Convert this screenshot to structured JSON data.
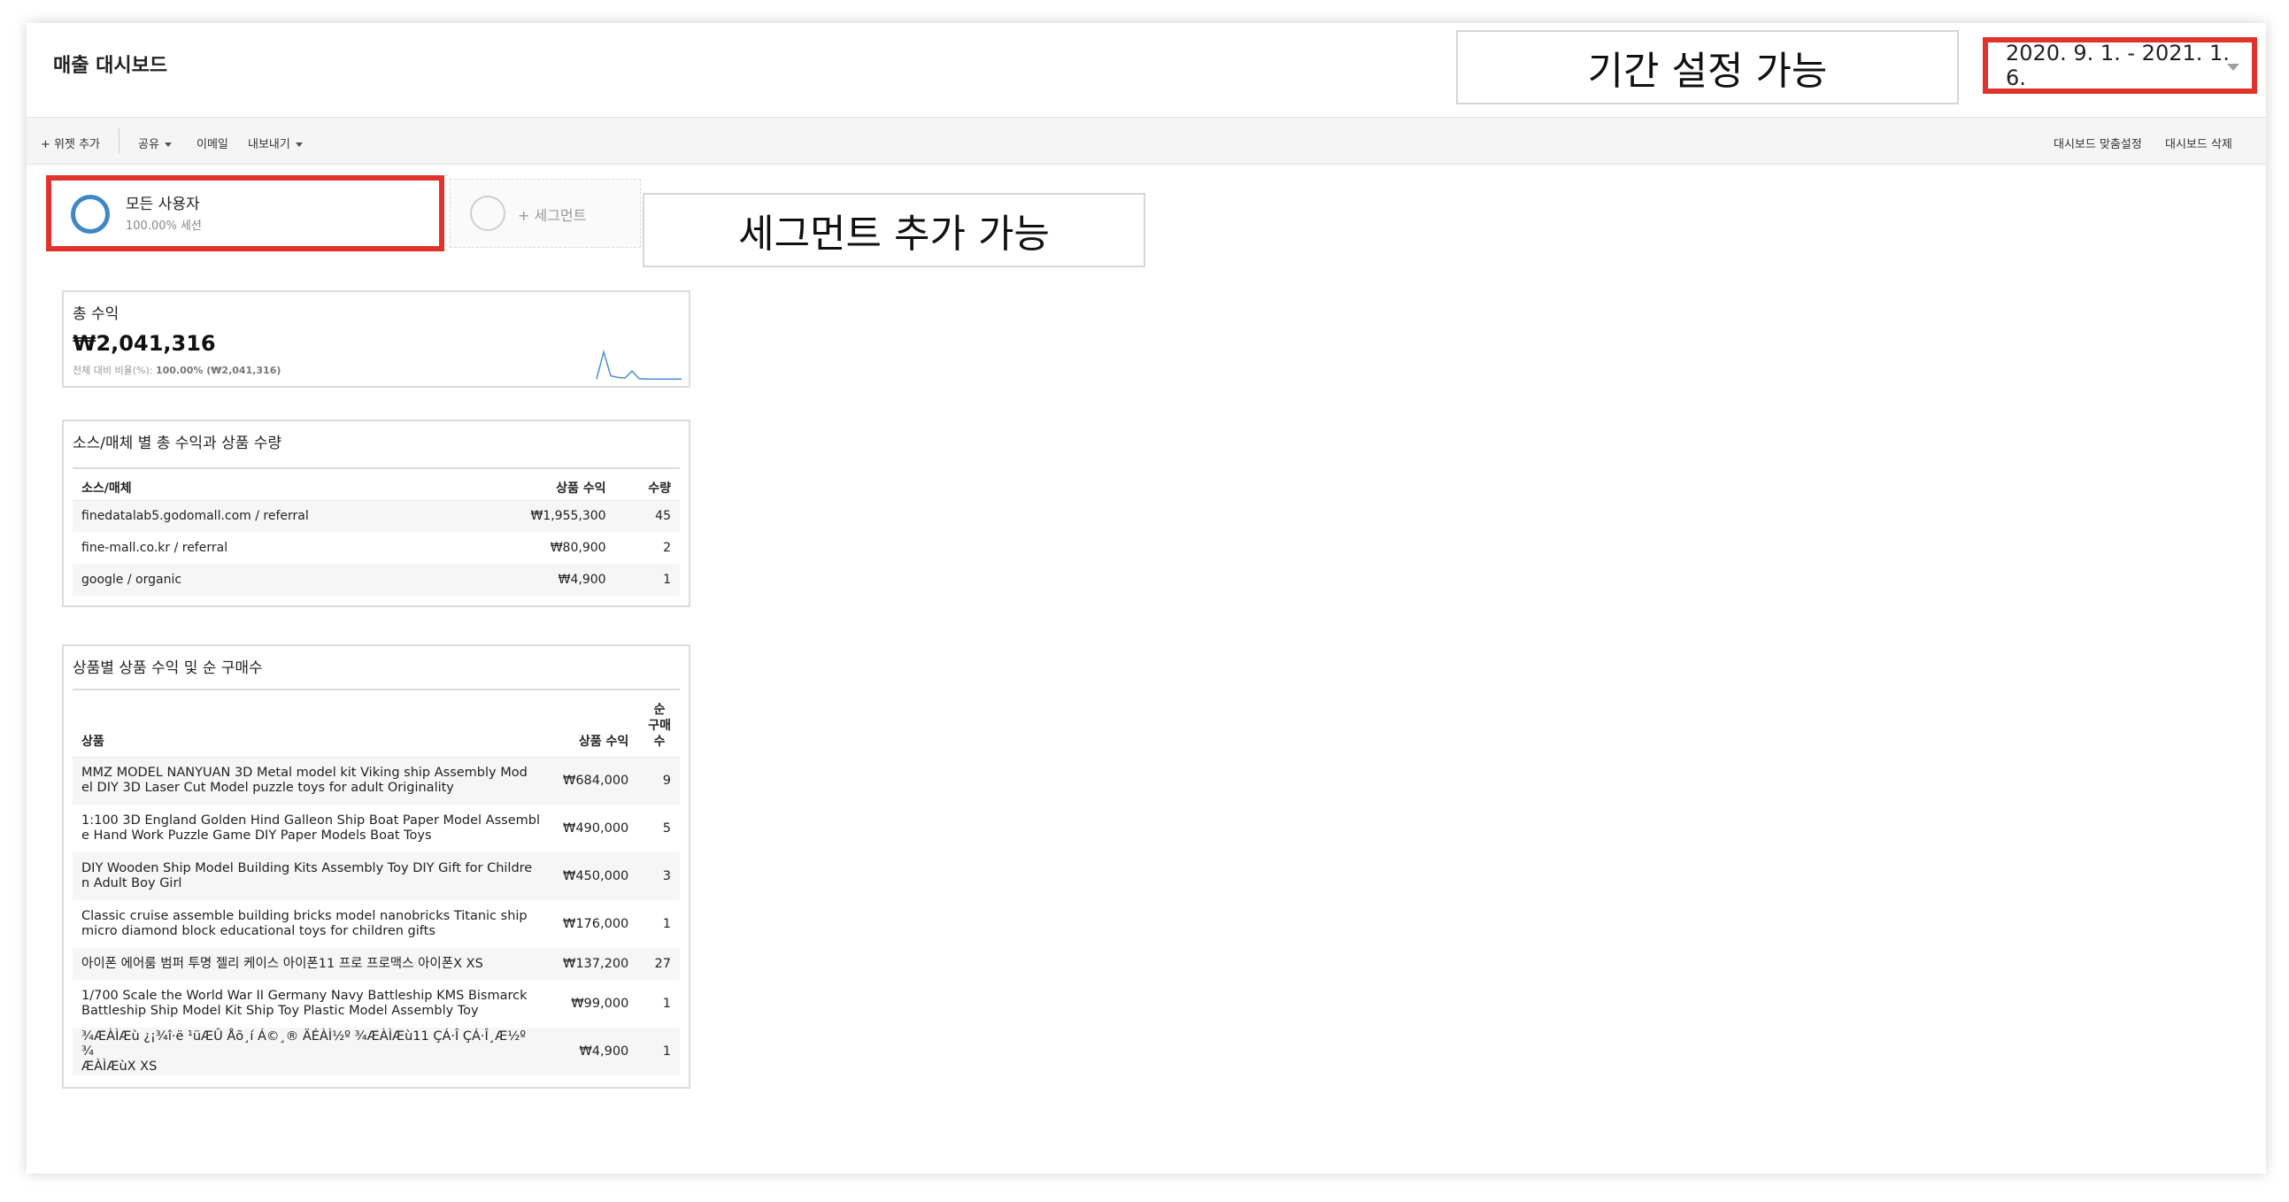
{
  "header": {
    "title": "매출 대시보드",
    "period_annotation": "기간 설정 가능",
    "date_range": "2020. 9. 1. - 2021. 1. 6."
  },
  "toolbar": {
    "add_widget": "+ 위젯 추가",
    "share": "공유",
    "email": "이메일",
    "export": "내보내기",
    "customize": "대시보드 맞춤설정",
    "delete": "대시보드 삭제"
  },
  "segments": {
    "active_name": "모든 사용자",
    "active_sub": "100.00% 세션",
    "add_label": "+ 세그먼트",
    "annotation": "세그먼트 추가 가능"
  },
  "revenue_widget": {
    "title": "총 수익",
    "value": "₩2,041,316",
    "ratio_label": "전체 대비 비율(%):",
    "ratio_value": "100.00% (₩2,041,316)",
    "sparkline": [
      0.05,
      0.9,
      0.15,
      0.1,
      0.08,
      0.3,
      0.06,
      0.05,
      0.05,
      0.05,
      0.05,
      0.05,
      0.05
    ]
  },
  "source_widget": {
    "title": "소스/매체 별 총 수익과 상품 수량",
    "headers": [
      "소스/매체",
      "상품 수익",
      "수량"
    ],
    "rows": [
      {
        "source": "finedatalab5.godomall.com / referral",
        "revenue": "₩1,955,300",
        "qty": "45"
      },
      {
        "source": "fine-mall.co.kr / referral",
        "revenue": "₩80,900",
        "qty": "2"
      },
      {
        "source": "google / organic",
        "revenue": "₩4,900",
        "qty": "1"
      }
    ]
  },
  "product_widget": {
    "title": "상품별 상품 수익 및 순 구매수",
    "headers": {
      "product": "상품",
      "revenue": "상품 수익",
      "purchases_1": "순",
      "purchases_2": "구매",
      "purchases_3": "수"
    },
    "rows": [
      {
        "name_1": "MMZ MODEL NANYUAN 3D Metal model kit Viking ship Assembly Mod",
        "name_2": "el DIY 3D Laser Cut Model puzzle toys for adult Originality",
        "revenue": "₩684,000",
        "count": "9"
      },
      {
        "name_1": "1:100 3D England Golden Hind Galleon Ship Boat Paper Model Assembl",
        "name_2": "e Hand Work Puzzle Game DIY Paper Models Boat Toys",
        "revenue": "₩490,000",
        "count": "5"
      },
      {
        "name_1": "DIY Wooden Ship Model Building Kits Assembly Toy DIY Gift for Childre",
        "name_2": "n Adult Boy Girl",
        "revenue": "₩450,000",
        "count": "3"
      },
      {
        "name_1": "Classic cruise assemble building bricks model nanobricks Titanic ship",
        "name_2": "micro diamond block educational toys for children gifts",
        "revenue": "₩176,000",
        "count": "1"
      },
      {
        "name_1": "아이폰 에어룸 범퍼 투명 젤리 케이스 아이폰11 프로 프로맥스 아이폰X XS",
        "name_2": "",
        "revenue": "₩137,200",
        "count": "27"
      },
      {
        "name_1": "1/700 Scale the World War II Germany Navy Battleship KMS Bismarck",
        "name_2": "Battleship Ship Model Kit Ship Toy Plastic Model Assembly Toy",
        "revenue": "₩99,000",
        "count": "1"
      },
      {
        "name_1": "¾ÆÀÌÆù ¿¡¾î·ë ¹üÆÛ Åõ¸í Á©¸® ÄÉÀÌ½º ¾ÆÀÌÆù11 ÇÁ·Î ÇÁ·Î¸Æ½º ¾",
        "name_2": "ÆÀÌÆùX XS",
        "revenue": "₩4,900",
        "count": "1"
      }
    ]
  }
}
